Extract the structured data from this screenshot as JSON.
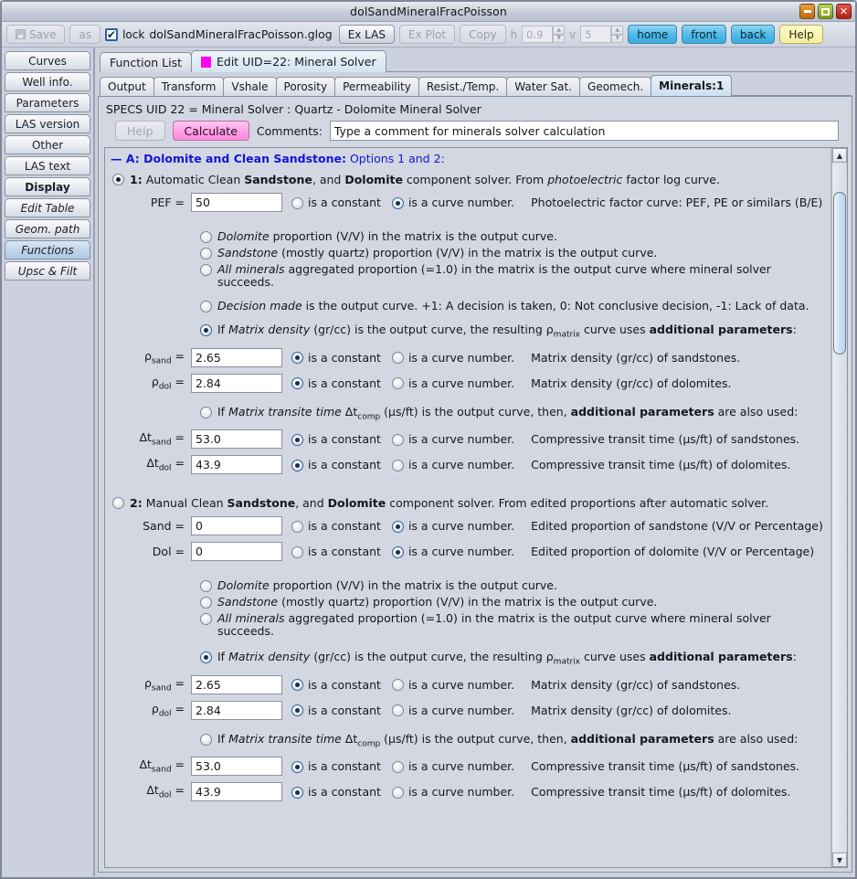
{
  "window": {
    "title": "dolSandMineralFracPoisson",
    "buttons": {
      "minimize": "minimize-button",
      "maximize": "maximize-button",
      "close": "close-button"
    }
  },
  "toolbar": {
    "save_label": "Save",
    "as_label": "as",
    "lock_label": "lock",
    "lock_checked": "✔",
    "filename": "dolSandMineralFracPoisson.glog",
    "ex_las_label": "Ex LAS",
    "ex_plot_label": "Ex Plot",
    "copy_label": "Copy",
    "h_label": "h",
    "h_value": "0.9",
    "v_label": "v",
    "v_value": "5",
    "home_label": "home",
    "front_label": "front",
    "back_label": "back",
    "help_label": "Help"
  },
  "sidebar": {
    "items": [
      {
        "label": "Curves"
      },
      {
        "label": "Well info."
      },
      {
        "label": "Parameters"
      },
      {
        "label": "LAS version"
      },
      {
        "label": "Other"
      },
      {
        "label": "LAS text"
      },
      {
        "label": "Display"
      },
      {
        "label": "Edit Table"
      },
      {
        "label": "Geom. path"
      },
      {
        "label": "Functions"
      },
      {
        "label": "Upsc & Filt"
      }
    ]
  },
  "tabs_top": [
    {
      "label": "Function List"
    },
    {
      "label": "Edit UID=22: Mineral Solver"
    }
  ],
  "tabs_sub": [
    {
      "label": "Output"
    },
    {
      "label": "Transform"
    },
    {
      "label": "Vshale"
    },
    {
      "label": "Porosity"
    },
    {
      "label": "Permeability"
    },
    {
      "label": "Resist./Temp."
    },
    {
      "label": "Water Sat."
    },
    {
      "label": "Geomech."
    },
    {
      "label": "Minerals:1"
    }
  ],
  "panel": {
    "specs_line": "SPECS UID 22 = Mineral Solver : Quartz - Dolomite Mineral Solver",
    "help_label": "Help",
    "calculate_label": "Calculate",
    "comments_label": "Comments:",
    "comments_value": "Type a comment for minerals solver calculation"
  },
  "section": {
    "header_bold": "— A: Dolomite and Clean Sandstone:",
    "header_rest": "Options 1 and 2:"
  },
  "option1": {
    "number": "1:",
    "title_parts": {
      "p1": "Automatic Clean ",
      "b1": "Sandstone",
      "p2": ", and ",
      "b2": "Dolomite",
      "p3": " component solver. From ",
      "i1": "photoelectric",
      "p4": " factor log curve."
    },
    "pef": {
      "label": "PEF =",
      "value": "50",
      "constant_label": "is a constant",
      "curve_label": "is a curve number.",
      "desc": "Photoelectric factor curve: PEF, PE or similars (B/E)"
    },
    "choices": [
      {
        "em": "Dolomite",
        "rest": " proportion (V/V) in the matrix is the output curve."
      },
      {
        "em": "Sandstone",
        "rest": " (mostly quartz) proportion (V/V) in the matrix is the output curve."
      },
      {
        "em": "All minerals",
        "rest": " aggregated proportion (=1.0) in the matrix is the output curve where mineral solver succeeds."
      },
      {
        "em": "Decision made",
        "rest": " is the output curve. +1: A decision is taken, 0: Not conclusive decision, -1: Lack of data."
      }
    ],
    "density_line": {
      "pre": "If ",
      "em": "Matrix density",
      "mid": " (gr/cc) is the output curve, the resulting ρ",
      "sub": "matrix",
      "mid2": " curve uses ",
      "bold": "additional parameters",
      "post": ":"
    },
    "rho_sand": {
      "label_main": "ρ",
      "label_sub": "sand",
      "label_eq": " =",
      "value": "2.65",
      "constant_label": "is a constant",
      "curve_label": "is a curve number.",
      "desc": "Matrix density (gr/cc) of sandstones."
    },
    "rho_dol": {
      "label_main": "ρ",
      "label_sub": "dol",
      "label_eq": " =",
      "value": "2.84",
      "constant_label": "is a constant",
      "curve_label": "is a curve number.",
      "desc": "Matrix density (gr/cc) of dolomites."
    },
    "transit_line": {
      "pre": "If ",
      "em": "Matrix transite time",
      "dt": " Δt",
      "sub": "comp",
      "mid": " (µs/ft) is the output curve, then, ",
      "bold": "additional parameters",
      "post": " are also used:"
    },
    "dt_sand": {
      "label_main": "Δt",
      "label_sub": "sand",
      "label_eq": " =",
      "value": "53.0",
      "constant_label": "is a constant",
      "curve_label": "is a curve number.",
      "desc": "Compressive transit time (µs/ft) of sandstones."
    },
    "dt_dol": {
      "label_main": "Δt",
      "label_sub": "dol",
      "label_eq": " =",
      "value": "43.9",
      "constant_label": "is a constant",
      "curve_label": "is a curve number.",
      "desc": "Compressive transit time (µs/ft) of dolomites."
    }
  },
  "option2": {
    "number": "2:",
    "title_parts": {
      "p1": "Manual Clean ",
      "b1": "Sandstone",
      "p2": ", and ",
      "b2": "Dolomite",
      "p3": " component solver. From edited proportions after automatic solver.",
      "i1": "",
      "p4": ""
    },
    "sand": {
      "label": "Sand =",
      "value": "0",
      "constant_label": "is a constant",
      "curve_label": "is a curve number.",
      "desc": "Edited proportion of sandstone (V/V or Percentage)"
    },
    "dol": {
      "label": "Dol =",
      "value": "0",
      "constant_label": "is a constant",
      "curve_label": "is a curve number.",
      "desc": "Edited proportion of dolomite (V/V or Percentage)"
    },
    "choices": [
      {
        "em": "Dolomite",
        "rest": " proportion (V/V) in the matrix is the output curve."
      },
      {
        "em": "Sandstone",
        "rest": " (mostly quartz) proportion (V/V) in the matrix is the output curve."
      },
      {
        "em": "All minerals",
        "rest": " aggregated proportion (=1.0) in the matrix is the output curve where mineral solver succeeds."
      }
    ],
    "density_line": {
      "pre": "If ",
      "em": "Matrix density",
      "mid": " (gr/cc) is the output curve, the resulting ρ",
      "sub": "matrix",
      "mid2": " curve uses ",
      "bold": "additional parameters",
      "post": ":"
    },
    "rho_sand": {
      "label_main": "ρ",
      "label_sub": "sand",
      "label_eq": " =",
      "value": "2.65",
      "constant_label": "is a constant",
      "curve_label": "is a curve number.",
      "desc": "Matrix density (gr/cc) of sandstones."
    },
    "rho_dol": {
      "label_main": "ρ",
      "label_sub": "dol",
      "label_eq": " =",
      "value": "2.84",
      "constant_label": "is a constant",
      "curve_label": "is a curve number.",
      "desc": "Matrix density (gr/cc) of dolomites."
    },
    "transit_line": {
      "pre": "If ",
      "em": "Matrix transite time",
      "dt": " Δt",
      "sub": "comp",
      "mid": " (µs/ft) is the output curve, then, ",
      "bold": "additional parameters",
      "post": " are also used:"
    },
    "dt_sand": {
      "label_main": "Δt",
      "label_sub": "sand",
      "label_eq": " =",
      "value": "53.0",
      "constant_label": "is a constant",
      "curve_label": "is a curve number.",
      "desc": "Compressive transit time (µs/ft) of sandstones."
    },
    "dt_dol": {
      "label_main": "Δt",
      "label_sub": "dol",
      "label_eq": " =",
      "value": "43.9",
      "constant_label": "is a constant",
      "curve_label": "is a curve number.",
      "desc": "Compressive transit time (µs/ft) of dolomites."
    }
  },
  "scrollbar": {
    "up": "▲",
    "down": "▼"
  },
  "colors": {
    "accent_blue": "#1414d2",
    "tab_magenta": "#ff00f2",
    "calculate_pink": "#ff9ce6",
    "button_blue": "#4cb8e8",
    "help_yellow": "#f4efa0"
  }
}
